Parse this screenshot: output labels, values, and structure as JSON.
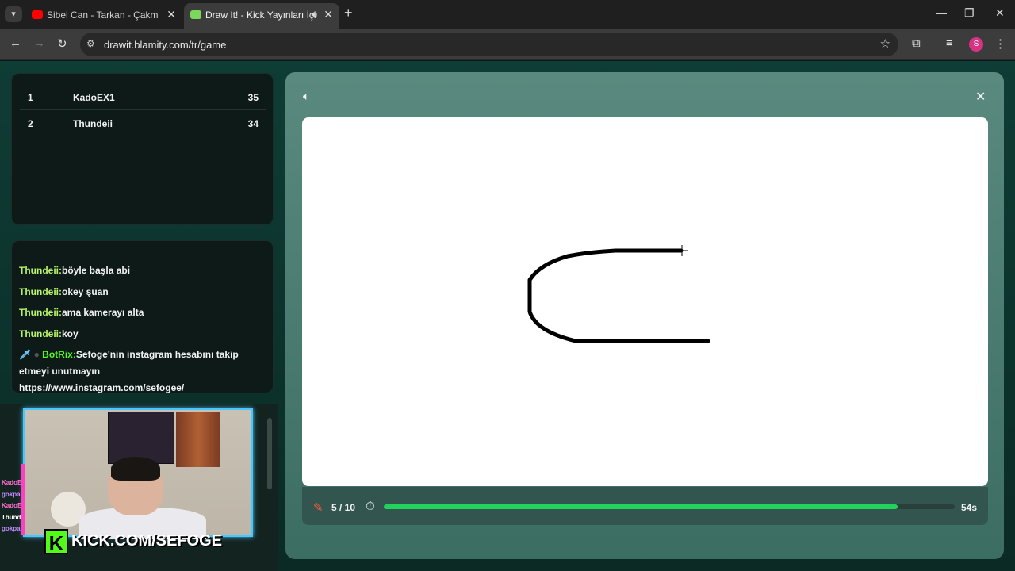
{
  "browser": {
    "tabs": [
      {
        "title": "Sibel Can - Tarkan - Çakmak Ça",
        "active": false
      },
      {
        "title": "Draw It! - Kick Yayınları İçin",
        "active": true
      }
    ],
    "url": "drawit.blamity.com/tr/game",
    "profile_initial": "S"
  },
  "leaderboard": [
    {
      "rank": "1",
      "name": "KadoEX1",
      "score": "35"
    },
    {
      "rank": "2",
      "name": "Thundeii",
      "score": "34"
    }
  ],
  "chat": [
    {
      "user": "Thundeii:",
      "text": "böyle başla abi"
    },
    {
      "user": "Thundeii:",
      "text": "okey şuan"
    },
    {
      "user": "Thundeii:",
      "text": "ama kamerayı alta"
    },
    {
      "user": "Thundeii:",
      "text": "koy"
    },
    {
      "user": "BotRix:",
      "text": "Sefoge'nin instagram hesabını takip etmeyi unutmayın https://www.instagram.com/sefogee/"
    }
  ],
  "webcam": {
    "banner": "KICK.COM/SEFOGE",
    "mini_chat": [
      "KadoE",
      "gokpa",
      "KadoE",
      "Thund",
      "gokpa"
    ]
  },
  "game": {
    "round": "5 / 10",
    "time_left": "54s",
    "timer_progress": 0.9,
    "colors": {
      "progress": "#21d35b",
      "pencil": "#ff5a3c",
      "chat_user": "#b8f36a",
      "bot": "#53fc18"
    }
  }
}
